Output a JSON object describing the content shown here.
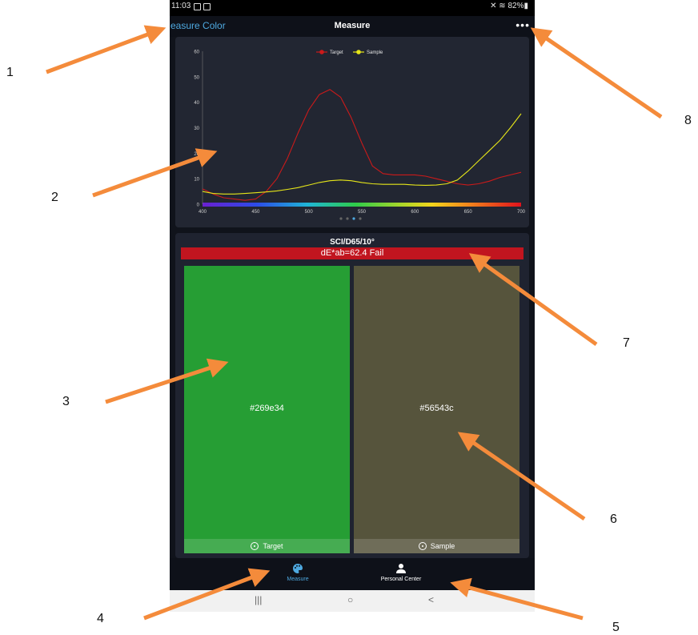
{
  "status": {
    "time": "11:03",
    "battery": "82%"
  },
  "header": {
    "back_label": "Measure Color",
    "title": "Measure",
    "more": "•••"
  },
  "colors": {
    "accent": "#4ea9e0",
    "target_line": "#cc1a1a",
    "sample_line": "#e6e619",
    "fail": "#c1151f",
    "target_swatch": "#269e34",
    "sample_swatch": "#56543c"
  },
  "chart_data": {
    "type": "line",
    "legend": [
      "Target",
      "Sample"
    ],
    "x_ticks": [
      "400",
      "450",
      "500",
      "550",
      "600",
      "650",
      "700"
    ],
    "y_ticks": [
      "0",
      "10",
      "20",
      "30",
      "40",
      "50",
      "60"
    ],
    "xlim": [
      400,
      700
    ],
    "ylim": [
      0,
      60
    ],
    "series": [
      {
        "name": "Target",
        "color": "#cc1a1a",
        "x": [
          400,
          410,
          420,
          430,
          440,
          450,
          460,
          470,
          480,
          490,
          500,
          510,
          520,
          530,
          540,
          550,
          560,
          570,
          580,
          590,
          600,
          610,
          620,
          630,
          640,
          650,
          660,
          670,
          680,
          690,
          700
        ],
        "y": [
          6,
          4,
          2.5,
          2,
          1.5,
          2,
          5,
          10,
          18,
          28,
          37,
          43,
          45,
          42,
          34,
          24,
          15,
          12,
          11.5,
          11.5,
          11.5,
          11,
          10,
          9,
          8,
          7.5,
          8,
          9,
          10.5,
          11.5,
          12.5
        ]
      },
      {
        "name": "Sample",
        "color": "#e6e619",
        "x": [
          400,
          410,
          420,
          430,
          440,
          450,
          460,
          470,
          480,
          490,
          500,
          510,
          520,
          530,
          540,
          550,
          560,
          570,
          580,
          590,
          600,
          610,
          620,
          630,
          640,
          650,
          660,
          670,
          680,
          690,
          700
        ],
        "y": [
          5,
          4.2,
          4,
          4,
          4.2,
          4.5,
          4.8,
          5.2,
          5.8,
          6.5,
          7.5,
          8.5,
          9.2,
          9.5,
          9.2,
          8.5,
          8,
          7.8,
          7.8,
          7.8,
          7.5,
          7.4,
          7.5,
          8,
          9.5,
          13,
          17,
          21,
          25,
          30,
          35.5
        ]
      }
    ],
    "pager": {
      "count": 4,
      "active": 2
    }
  },
  "compare": {
    "condition": "SCI/D65/10°",
    "delta": "dE*ab=62.4 Fail",
    "target": {
      "hex": "#269e34",
      "label": "Target"
    },
    "sample": {
      "hex": "#56543c",
      "label": "Sample"
    }
  },
  "nav": {
    "measure": "Measure",
    "personal": "Personal Center"
  },
  "sysnav": {
    "recent": "|||",
    "home": "○",
    "back": "<"
  },
  "callouts": [
    "1",
    "2",
    "3",
    "4",
    "5",
    "6",
    "7",
    "8"
  ]
}
